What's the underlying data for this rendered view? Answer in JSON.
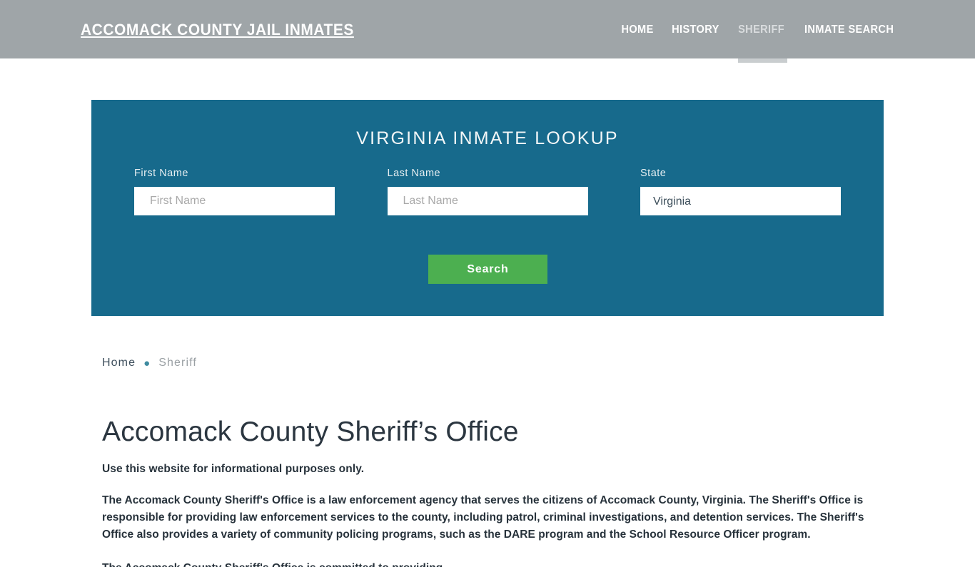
{
  "header": {
    "brand": "ACCOMACK COUNTY JAIL INMATES",
    "nav": [
      {
        "label": "HOME",
        "active": false
      },
      {
        "label": "HISTORY",
        "active": false
      },
      {
        "label": "SHERIFF",
        "active": true
      },
      {
        "label": "INMATE SEARCH",
        "active": false
      }
    ],
    "background_color": "#9fa5a8",
    "active_indicator_color": "#c9cdcf"
  },
  "lookup": {
    "title": "VIRGINIA INMATE LOOKUP",
    "panel_color": "#176a8c",
    "first_name": {
      "label": "First Name",
      "placeholder": "First Name",
      "value": ""
    },
    "last_name": {
      "label": "Last Name",
      "placeholder": "Last Name",
      "value": ""
    },
    "state": {
      "label": "State",
      "selected": "Virginia",
      "options": [
        "Virginia"
      ]
    },
    "search_button": {
      "label": "Search",
      "color": "#4caf50"
    }
  },
  "breadcrumb": {
    "home": "Home",
    "separator": "●",
    "current": "Sheriff"
  },
  "main": {
    "title": "Accomack County Sheriff’s Office",
    "lead": "Use this website for informational purposes only.",
    "paragraph": "The Accomack County Sheriff's Office is a law enforcement agency that serves the citizens of Accomack County, Virginia. The Sheriff's Office is responsible for providing law enforcement services to the county, including patrol, criminal investigations, and detention services. The Sheriff's Office also provides a variety of community policing programs, such as the DARE program and the School Resource Officer program.",
    "paragraph_next_clipped": "The Accomack County Sheriff's Office is committed to providing"
  }
}
